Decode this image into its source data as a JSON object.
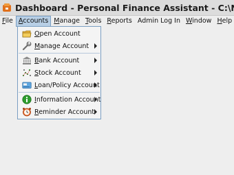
{
  "window": {
    "title": "Dashboard - Personal Finance Assistant - C:\\Niraj\\Personal\\F"
  },
  "menubar": {
    "items": [
      {
        "id": "file",
        "label": "File",
        "mnemonic": "F",
        "rest": "ile"
      },
      {
        "id": "accounts",
        "label": "Accounts",
        "mnemonic": "A",
        "rest": "ccounts",
        "active": true
      },
      {
        "id": "manage",
        "label": "Manage",
        "mnemonic": "M",
        "rest": "anage"
      },
      {
        "id": "tools",
        "label": "Tools",
        "mnemonic": "T",
        "rest": "ools"
      },
      {
        "id": "reports",
        "label": "Reports",
        "mnemonic": "R",
        "rest": "eports"
      },
      {
        "id": "admin",
        "label": "Admin Log In",
        "mnemonic": "",
        "rest": "Admin Log In"
      },
      {
        "id": "window",
        "label": "Window",
        "mnemonic": "W",
        "rest": "indow"
      },
      {
        "id": "help",
        "label": "Help",
        "mnemonic": "H",
        "rest": "elp"
      }
    ]
  },
  "accounts_menu": {
    "groups": [
      [
        {
          "label": "Open Account",
          "mnemonic": "O",
          "rest": "pen Account",
          "icon": "folder-icon",
          "submenu": false
        },
        {
          "label": "Manage Account",
          "mnemonic": "M",
          "rest": "anage Account",
          "icon": "wrench-icon",
          "submenu": true
        }
      ],
      [
        {
          "label": "Bank Account",
          "mnemonic": "B",
          "rest": "ank Account",
          "icon": "bank-icon",
          "submenu": true
        },
        {
          "label": "Stock Account",
          "mnemonic": "S",
          "rest": "tock Account",
          "icon": "stock-chart-icon",
          "submenu": true
        },
        {
          "label": "Loan/Policy Account",
          "mnemonic": "L",
          "rest": "oan/Policy Account",
          "icon": "loan-card-icon",
          "submenu": true
        }
      ],
      [
        {
          "label": "Information Account",
          "mnemonic": "I",
          "rest": "nformation Account",
          "icon": "info-icon",
          "submenu": true
        },
        {
          "label": "Reminder Account",
          "mnemonic": "R",
          "rest": "eminder Account",
          "icon": "alarm-clock-icon",
          "submenu": true
        }
      ]
    ]
  },
  "colors": {
    "menu_highlight": "#b8cfe5",
    "menu_border": "#7a9ec2",
    "background": "#eeeeee"
  }
}
